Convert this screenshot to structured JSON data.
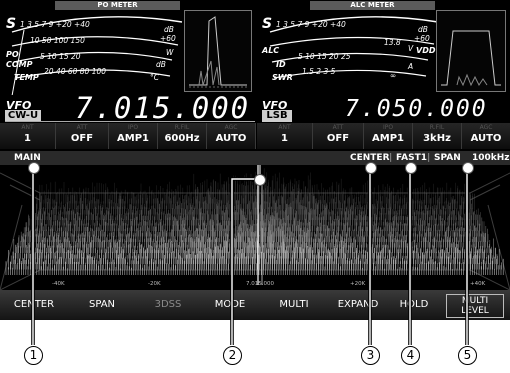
{
  "po_meter": {
    "title": "PO METER",
    "s_label": "S",
    "s_scale": "1  3  5  7  9  +20  +40",
    "s_db": "dB",
    "s_db60": "+60",
    "po_label": "PO",
    "po_scale": "10  50  100  150",
    "po_unit": "W",
    "comp_label": "COMP",
    "comp_scale": "5  10  15  20",
    "comp_unit": "dB",
    "temp_label": "TEMP",
    "temp_scale": "20  40  60  80  100",
    "temp_unit": "°C"
  },
  "alc_meter": {
    "title": "ALC METER",
    "s_label": "S",
    "s_scale": "1  3  5  7  9  +20  +40",
    "s_db": "dB",
    "s_db60": "+60",
    "alc_label": "ALC",
    "vdd_value": "13.8",
    "vdd_unit": "V",
    "vdd_label": "VDD",
    "id_label": "ID",
    "id_scale": "5  10  15  20  25",
    "id_unit": "A",
    "swr_label": "SWR",
    "swr_scale": "1.5  2  3  5",
    "swr_inf": "∞"
  },
  "vfo_main": {
    "label": "VFO",
    "mode": "CW-U",
    "frequency": "7.015.000"
  },
  "vfo_sub": {
    "label": "VFO",
    "mode": "LSB",
    "frequency": "7.050.000"
  },
  "status_main": [
    {
      "cap": "ANT",
      "val": "1"
    },
    {
      "cap": "ATT",
      "val": "OFF"
    },
    {
      "cap": "IPO",
      "val": "AMP1"
    },
    {
      "cap": "R.FIL",
      "val": "600Hz"
    },
    {
      "cap": "AGC",
      "val": "AUTO"
    }
  ],
  "status_sub": [
    {
      "cap": "ANT",
      "val": "1"
    },
    {
      "cap": "ATT",
      "val": "OFF"
    },
    {
      "cap": "IPO",
      "val": "AMP1"
    },
    {
      "cap": "R.FIL",
      "val": "3kHz"
    },
    {
      "cap": "AGC",
      "val": "AUTO"
    }
  ],
  "scope_header": {
    "main": "MAIN",
    "center": "CENTER",
    "fast": "FAST1",
    "span_label": "SPAN",
    "span_value": "100kHz"
  },
  "freq_axis": [
    "-40K",
    "-20K",
    "7.015.000",
    "+20K",
    "+40K"
  ],
  "function_bar": {
    "center": "CENTER",
    "span": "SPAN",
    "dss": "3DSS",
    "mode": "MODE",
    "multi": "MULTI",
    "expand": "EXPAND",
    "hold": "HOLD",
    "multi_level_1": "MULTI",
    "multi_level_2": "LEVEL"
  },
  "callouts": [
    "1",
    "2",
    "3",
    "4",
    "5"
  ]
}
